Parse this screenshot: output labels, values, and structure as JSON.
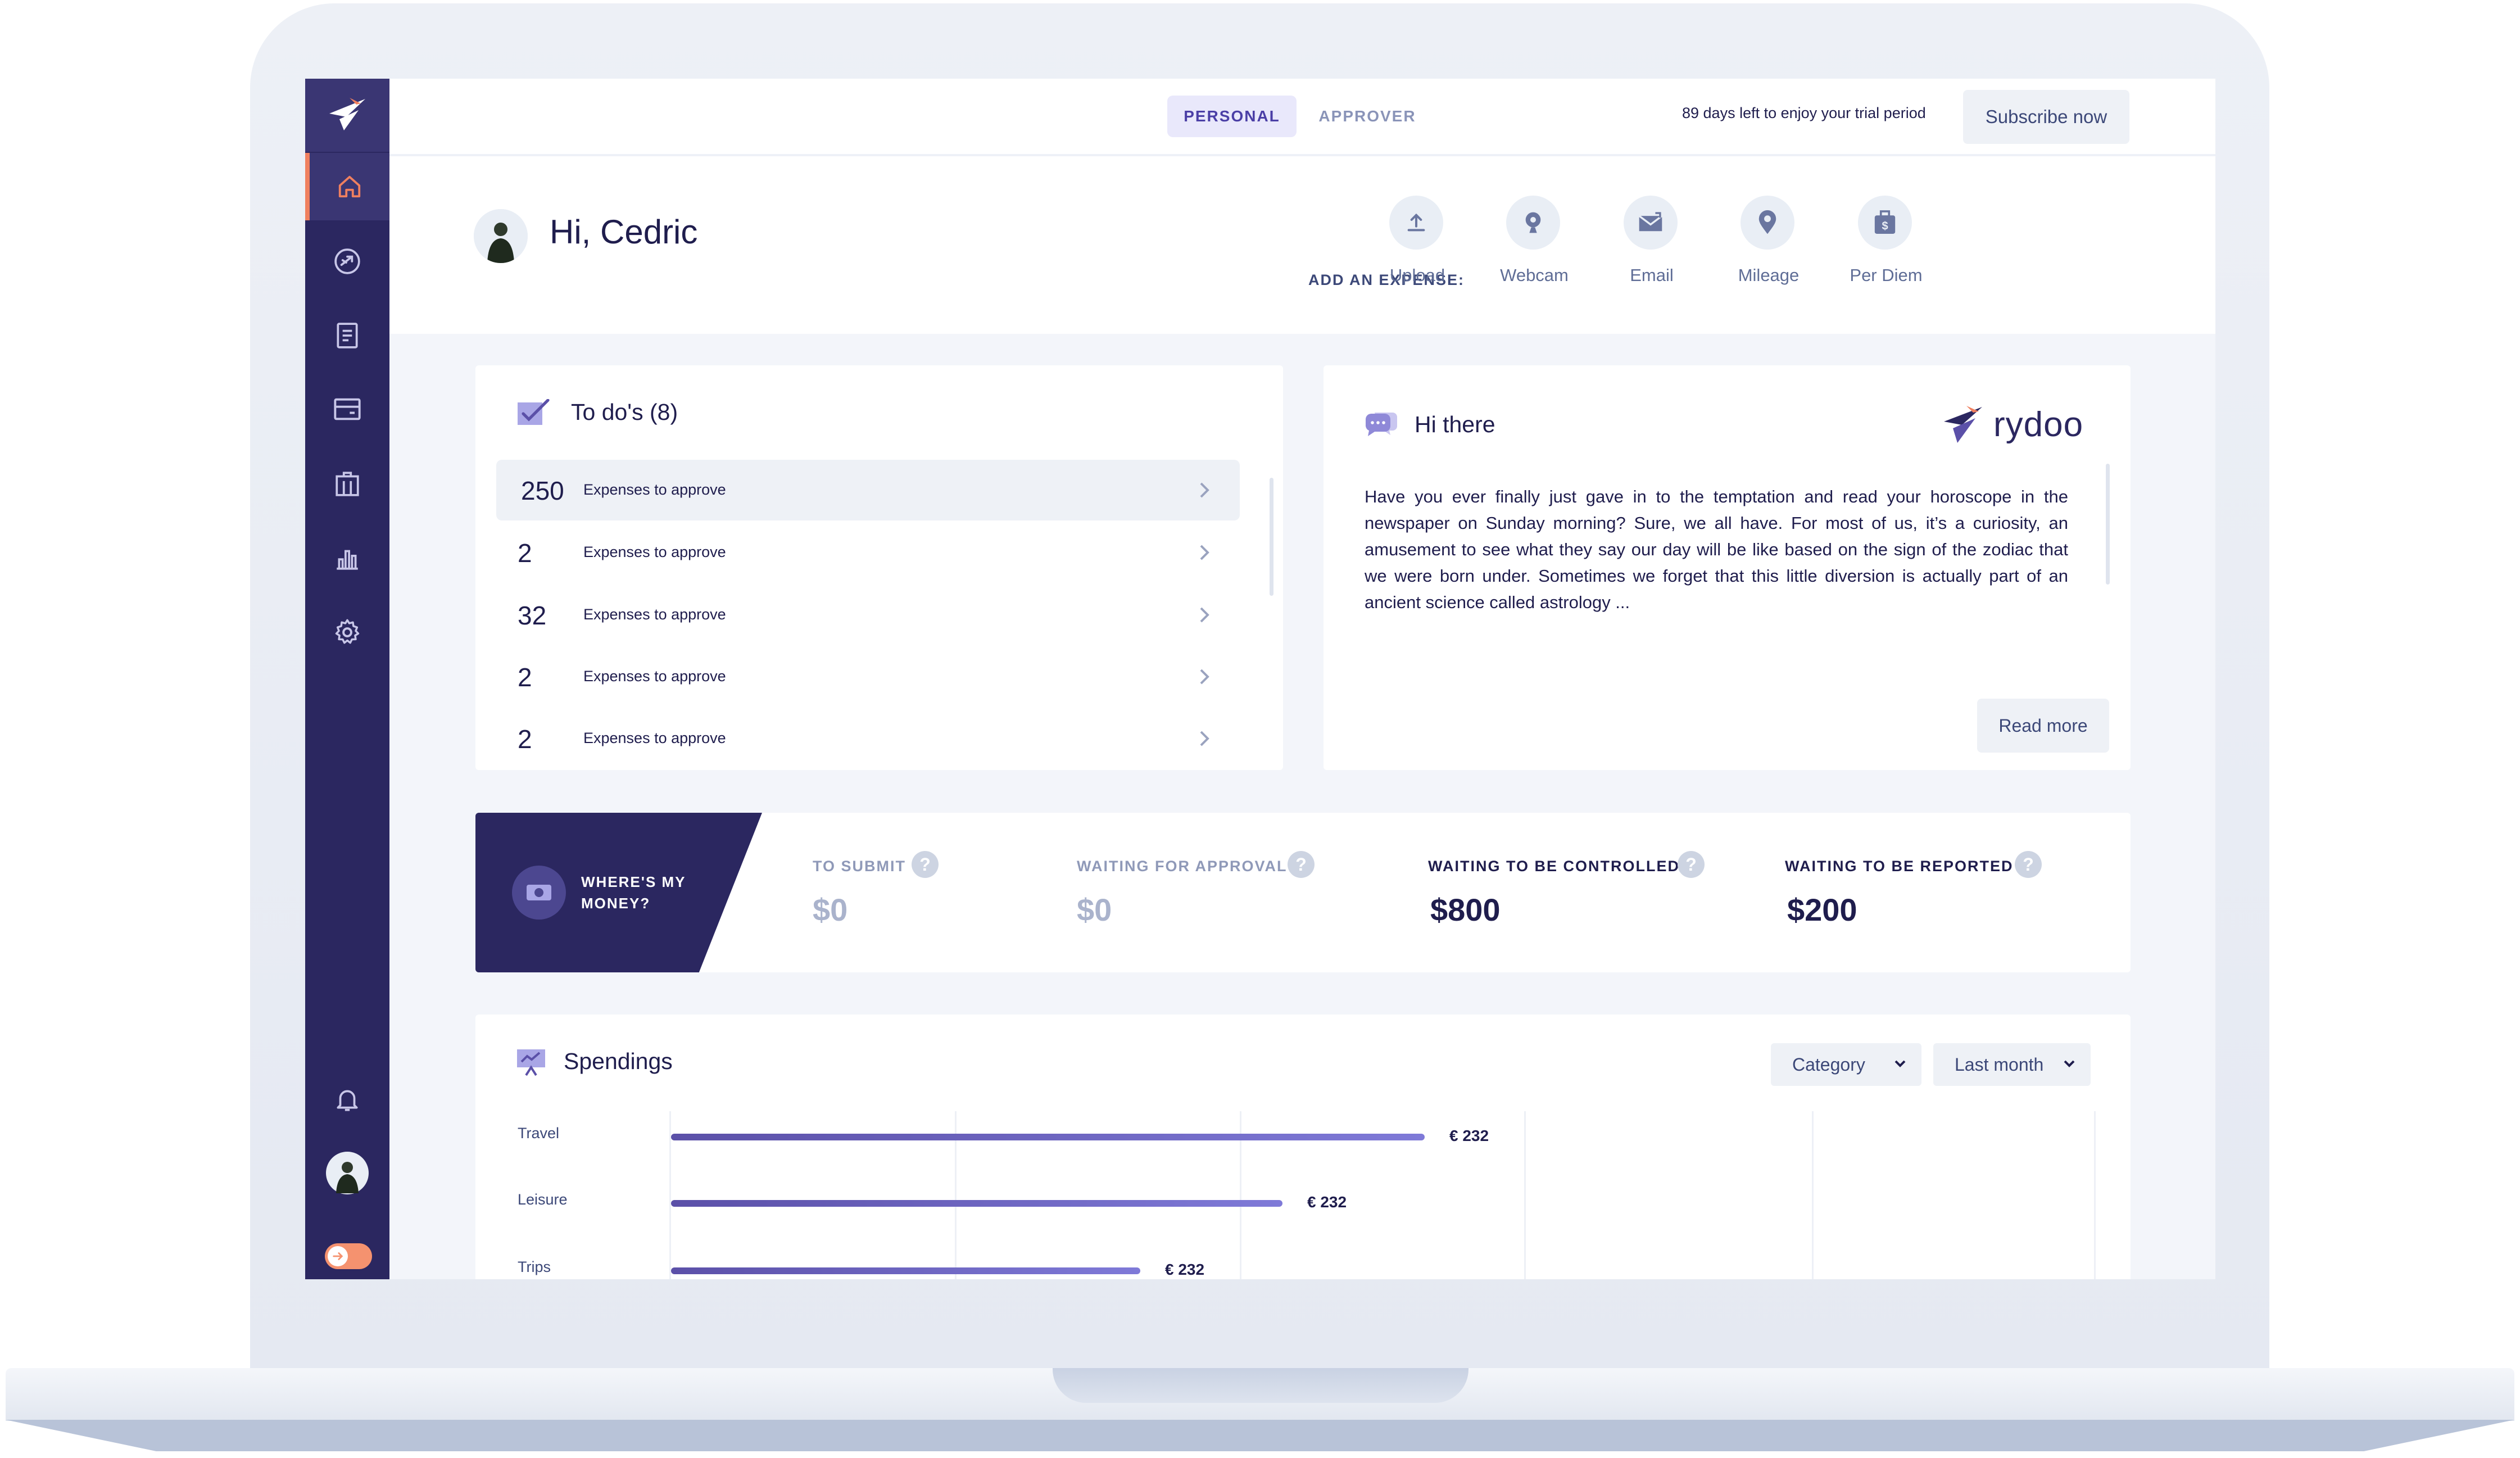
{
  "tabs": {
    "personal": "PERSONAL",
    "approver": "APPROVER"
  },
  "trial": {
    "text": "89 days left to enjoy your trial period",
    "subscribe_label": "Subscribe now"
  },
  "greeting": {
    "title": "Hi, Cedric"
  },
  "add_expense": {
    "label": "ADD AN EXPENSE:",
    "options": [
      {
        "label": "Upload",
        "icon": "upload-icon"
      },
      {
        "label": "Webcam",
        "icon": "webcam-icon"
      },
      {
        "label": "Email",
        "icon": "email-icon"
      },
      {
        "label": "Mileage",
        "icon": "location-pin-icon"
      },
      {
        "label": "Per Diem",
        "icon": "per-diem-icon"
      }
    ]
  },
  "todos": {
    "title": "To do's (8)",
    "items": [
      {
        "count": "250",
        "text": "Expenses to approve"
      },
      {
        "count": "2",
        "text": "Expenses to approve"
      },
      {
        "count": "32",
        "text": "Expenses to approve"
      },
      {
        "count": "2",
        "text": "Expenses to approve"
      },
      {
        "count": "2",
        "text": "Expenses to approve"
      }
    ]
  },
  "hithere": {
    "title": "Hi there",
    "brand": "rydoo",
    "body": "Have you ever finally just gave in to the temptation and read your horoscope in the newspaper on Sunday morning? Sure, we all have. For most of us, it’s a curiosity, an amusement to see what they say our day will be like based on the sign of the zodiac that we were born under. Sometimes we forget that this little diversion is actually part of an ancient science called astrology ...",
    "read_more": "Read more"
  },
  "money": {
    "title": "WHERE'S MY MONEY?",
    "stats": [
      {
        "label": "TO SUBMIT",
        "value": "$0"
      },
      {
        "label": "WAITING FOR APPROVAL",
        "value": "$0"
      },
      {
        "label": "WAITING TO BE CONTROLLED",
        "value": "$800"
      },
      {
        "label": "WAITING TO BE REPORTED",
        "value": "$200"
      }
    ]
  },
  "spendings": {
    "title": "Spendings",
    "filter_category": "Category",
    "filter_period": "Last month"
  },
  "chart_data": {
    "type": "bar",
    "orientation": "horizontal",
    "categories": [
      "Travel",
      "Leisure",
      "Trips"
    ],
    "values": [
      232,
      232,
      232
    ],
    "value_labels": [
      "€ 232",
      "€ 232",
      "€ 232"
    ],
    "bar_fraction": [
      0.53,
      0.43,
      0.33
    ],
    "grid": true
  },
  "colors": {
    "sidebar": "#2b2760",
    "accent": "#f0805f",
    "primary_text": "#1f1d4d",
    "tab_active_bg": "#e9e8fb",
    "bar": "#5b50a8"
  }
}
